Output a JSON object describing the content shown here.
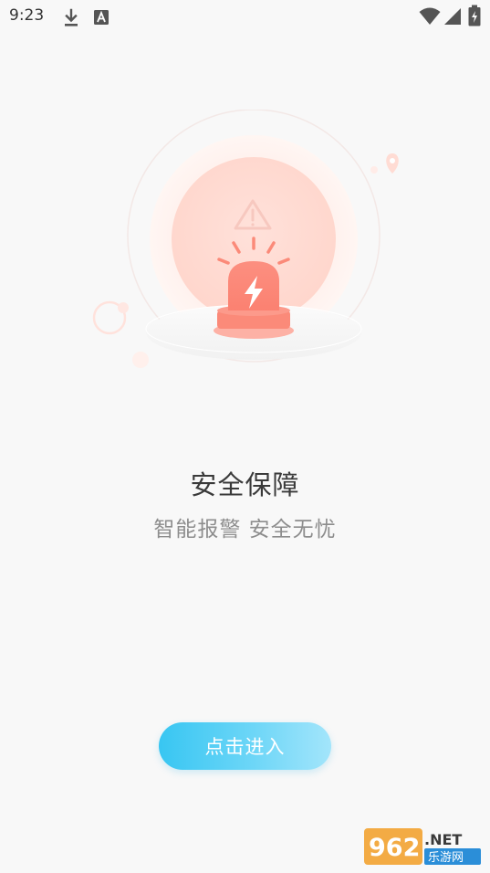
{
  "status_bar": {
    "time": "9:23",
    "icons": [
      "download-icon",
      "a-notification-icon",
      "wifi-icon",
      "signal-icon",
      "battery-charging-icon"
    ]
  },
  "illustration": {
    "icon": "alarm-siren-icon",
    "warning_icon": "warning-triangle-icon",
    "bolt_icon": "lightning-bolt-icon",
    "accent_color": "#fb8a79"
  },
  "content": {
    "title": "安全保障",
    "subtitle": "智能报警 安全无忧"
  },
  "enter_button": {
    "label": "点击进入",
    "color": "#38c6f2"
  },
  "watermark": {
    "brand": "962.NET",
    "sub": "乐游网"
  }
}
